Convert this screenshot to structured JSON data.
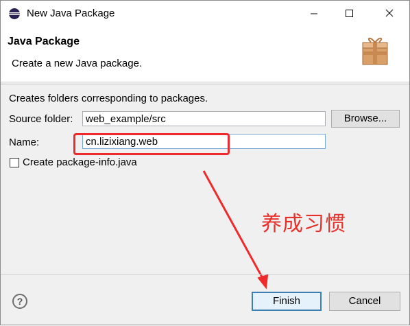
{
  "window": {
    "title": "New Java Package",
    "controls": {
      "minimize": "—",
      "maximize": "☐",
      "close": "✕"
    }
  },
  "header": {
    "title": "Java Package",
    "description": "Create a new Java package.",
    "icon": "package-wizard-icon"
  },
  "form": {
    "description": "Creates folders corresponding to packages.",
    "source_folder_label": "Source folder:",
    "source_folder_value": "web_example/src",
    "browse_label": "Browse...",
    "name_label": "Name:",
    "name_value": "cn.lizixiang.web",
    "checkbox_label": "Create package-info.java",
    "checkbox_checked": false
  },
  "annotation": {
    "text": "养成习惯",
    "color": "#e8302a"
  },
  "footer": {
    "help_label": "?",
    "finish_label": "Finish",
    "cancel_label": "Cancel"
  },
  "colors": {
    "accent": "#3c7fb1",
    "highlight": "#ee2a2a"
  }
}
